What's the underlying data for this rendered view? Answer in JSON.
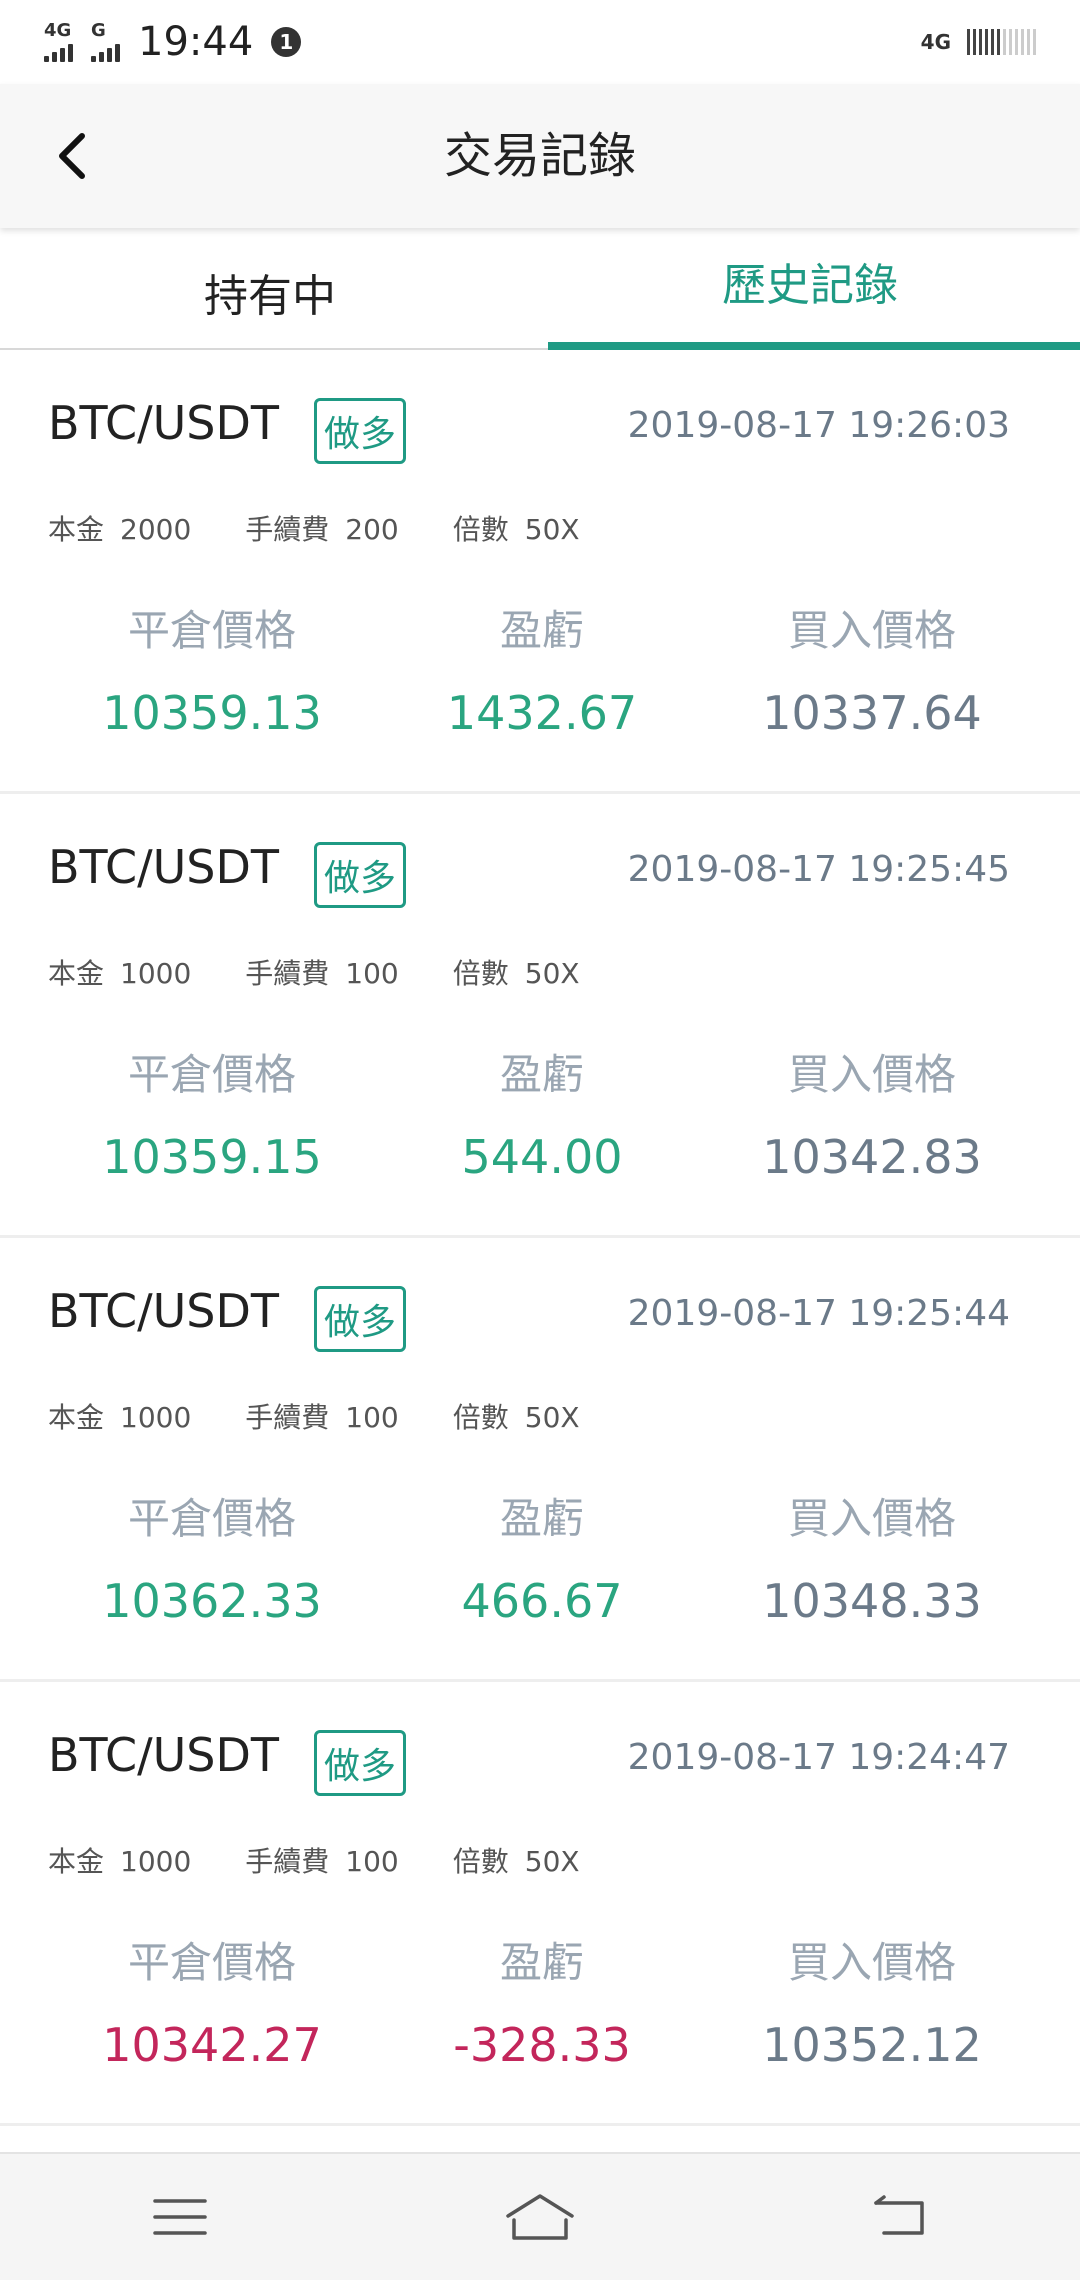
{
  "status_bar": {
    "network_left_1": "4G",
    "network_left_2": "G",
    "time": "19:44",
    "notification_count": "1",
    "network_right": "4G"
  },
  "header": {
    "title": "交易記錄"
  },
  "tabs": [
    {
      "label": "持有中",
      "active": false
    },
    {
      "label": "歷史記錄",
      "active": true
    }
  ],
  "labels": {
    "principal": "本金",
    "fee": "手續費",
    "leverage": "倍數",
    "close_price": "平倉價格",
    "pnl": "盈虧",
    "buy_price": "買入價格"
  },
  "colors": {
    "accent": "#1f9a84",
    "profit": "#2aa580",
    "loss": "#c3265b",
    "neutral": "#6b7a89"
  },
  "records": [
    {
      "pair": "BTC/USDT",
      "side": "做多",
      "time": "2019-08-17 19:26:03",
      "principal": "2000",
      "fee": "200",
      "leverage": "50X",
      "close_price": "10359.13",
      "pnl": "1432.67",
      "buy_price": "10337.64",
      "result": "profit"
    },
    {
      "pair": "BTC/USDT",
      "side": "做多",
      "time": "2019-08-17 19:25:45",
      "principal": "1000",
      "fee": "100",
      "leverage": "50X",
      "close_price": "10359.15",
      "pnl": "544.00",
      "buy_price": "10342.83",
      "result": "profit"
    },
    {
      "pair": "BTC/USDT",
      "side": "做多",
      "time": "2019-08-17 19:25:44",
      "principal": "1000",
      "fee": "100",
      "leverage": "50X",
      "close_price": "10362.33",
      "pnl": "466.67",
      "buy_price": "10348.33",
      "result": "profit"
    },
    {
      "pair": "BTC/USDT",
      "side": "做多",
      "time": "2019-08-17 19:24:47",
      "principal": "1000",
      "fee": "100",
      "leverage": "50X",
      "close_price": "10342.27",
      "pnl": "-328.33",
      "buy_price": "10352.12",
      "result": "loss"
    }
  ],
  "bottom_nav": {
    "menu_icon": "menu-icon",
    "home_icon": "home-icon",
    "back_icon": "back-icon"
  }
}
